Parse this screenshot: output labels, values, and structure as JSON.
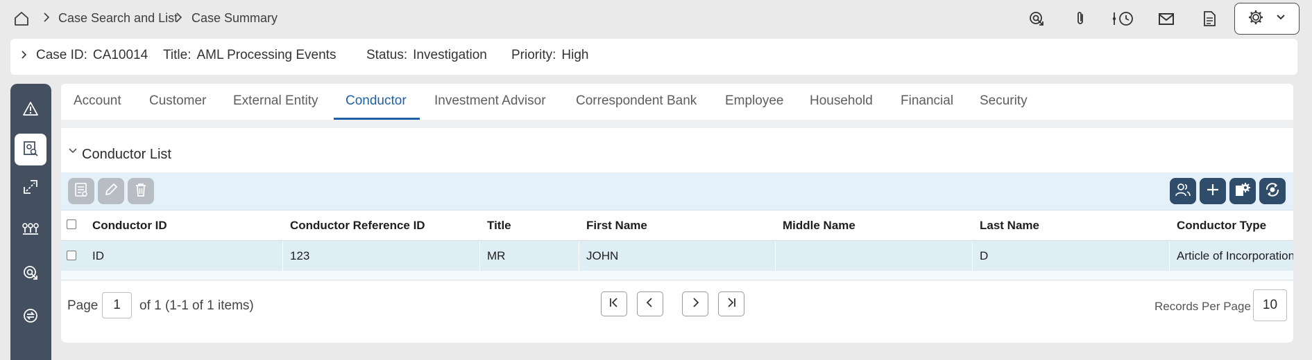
{
  "breadcrumb": {
    "home_icon": "home-icon",
    "items": [
      "Case Search and List",
      "Case Summary"
    ]
  },
  "top_actions": [
    "target-icon",
    "paperclip-icon",
    "history-icon",
    "mail-icon",
    "document-icon",
    "gear-icon"
  ],
  "case": {
    "id_label": "Case ID:",
    "id_value": "CA10014",
    "title_label": "Title:",
    "title_value": "AML Processing Events",
    "status_label": "Status:",
    "status_value": "Investigation",
    "priority_label": "Priority:",
    "priority_value": "High"
  },
  "rail": [
    "alert-icon",
    "case-search-icon",
    "relationship-icon",
    "network-icon",
    "target-icon",
    "exchange-icon"
  ],
  "tabs": [
    "Account",
    "Customer",
    "External Entity",
    "Conductor",
    "Investment Advisor",
    "Correspondent Bank",
    "Employee",
    "Household",
    "Financial",
    "Security"
  ],
  "active_tab": "Conductor",
  "list": {
    "title": "Conductor List",
    "columns": [
      "Conductor ID",
      "Conductor Reference ID",
      "Title",
      "First Name",
      "Middle Name",
      "Last Name",
      "Conductor Type"
    ],
    "rows": [
      [
        "ID",
        "123",
        "MR",
        "JOHN",
        "",
        "D",
        "Article of Incorporation"
      ]
    ]
  },
  "pager": {
    "page_label": "Page",
    "page_value": "1",
    "of_text": "of 1 (1-1 of 1 items)",
    "records_label": "Records Per Page",
    "records_value": "10"
  },
  "colors": {
    "accent": "#1f5fa8",
    "rail": "#44505f",
    "toolbar_bg": "#e5f1fa",
    "dark_button": "#2f4d6b",
    "disabled_button": "#b8bdc4",
    "row_bg": "#dfedf5"
  }
}
